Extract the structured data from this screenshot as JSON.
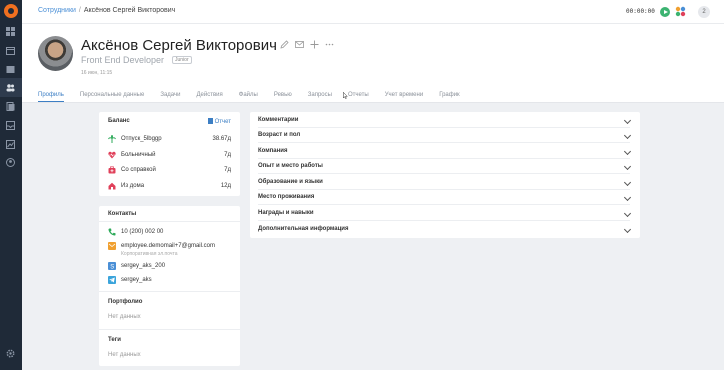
{
  "breadcrumb": {
    "parent": "Сотрудники",
    "separator": "/",
    "current": "Аксёнов Сергей Викторович"
  },
  "header": {
    "timer": "00:00:00",
    "notifications_count": "2"
  },
  "profile": {
    "name": "Аксёнов Сергей Викторович",
    "position": "Front End Developer",
    "level": "Junior",
    "date": "16 июн, 11:15",
    "tabs": [
      {
        "label": "Профиль",
        "active": true
      },
      {
        "label": "Персональные данные"
      },
      {
        "label": "Задачи"
      },
      {
        "label": "Действия"
      },
      {
        "label": "Файлы"
      },
      {
        "label": "Ревью"
      },
      {
        "label": "Запросы"
      },
      {
        "label": "Отчеты"
      },
      {
        "label": "Учет времени"
      },
      {
        "label": "График"
      }
    ]
  },
  "balance": {
    "title": "Баланс",
    "report_label": "Отчет",
    "rows": [
      {
        "label": "Отпуск_5lbggp",
        "value": "38.67д",
        "icon": "palm-icon",
        "color": "#2eaa5a"
      },
      {
        "label": "Больничный",
        "value": "7д",
        "icon": "heart-pulse-icon",
        "color": "#e0405a"
      },
      {
        "label": "Со справкой",
        "value": "7д",
        "icon": "medical-bag-icon",
        "color": "#e0405a"
      },
      {
        "label": "Из дома",
        "value": "12д",
        "icon": "house-icon",
        "color": "#e0405a"
      }
    ]
  },
  "contacts": {
    "title": "Контакты",
    "phone": "10 (200) 002 00",
    "email": "employee.demomail+7@gmail.com",
    "email_note": "Корпоративная эл.почта",
    "skype": "sergey_aks_200",
    "telegram": "sergey_aks",
    "portfolio_title": "Портфолио",
    "portfolio_value": "Нет данных",
    "tags_title": "Теги",
    "tags_value": "Нет данных"
  },
  "accordion": [
    "Комментарии",
    "Возраст и пол",
    "Компания",
    "Опыт и место работы",
    "Образование и языки",
    "Место проживания",
    "Награды и навыки",
    "Дополнительная информация"
  ],
  "colors": {
    "accent": "#3d7fc4",
    "sidebar": "#1f2a38",
    "logo": "#f07020",
    "play": "#3cb371"
  }
}
